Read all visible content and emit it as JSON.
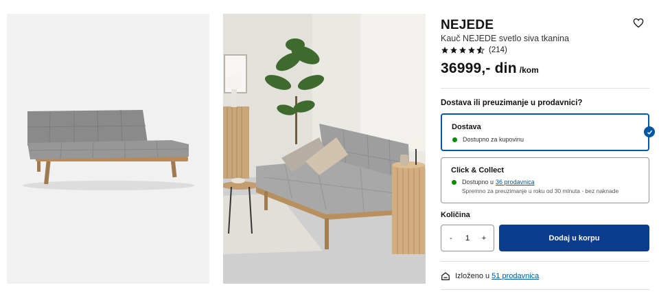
{
  "product": {
    "name": "NEJEDE",
    "description": "Kauč NEJEDE svetlo siva tkanina",
    "rating": 4.5,
    "review_count": "(214)",
    "price": "36999,- din",
    "price_unit": "/kom"
  },
  "icons": {
    "favorite": "heart-outline-icon",
    "rating": "star-icon",
    "selected": "check-circle-icon",
    "store": "store-icon"
  },
  "colors": {
    "accent": "#0058a3",
    "primary_button": "#0c3c8c",
    "available": "#0a8a00"
  },
  "delivery": {
    "heading": "Dostava ili preuzimanje u prodavnici?",
    "options": [
      {
        "title": "Dostava",
        "status": "Dostupno za kupovinu",
        "selected": true
      },
      {
        "title": "Click & Collect",
        "status_prefix": "Dostupno u",
        "status_link": "36 prodavnica",
        "note": "Spremno za preuzimanje u roku od 30 minuta - bez naknade",
        "selected": false
      }
    ]
  },
  "quantity": {
    "label": "Količina",
    "decrement": "-",
    "value": "1",
    "increment": "+"
  },
  "cart": {
    "add_label": "Dodaj u korpu"
  },
  "stores": {
    "prefix": "Izloženo u",
    "link": "51 prodavnica"
  }
}
